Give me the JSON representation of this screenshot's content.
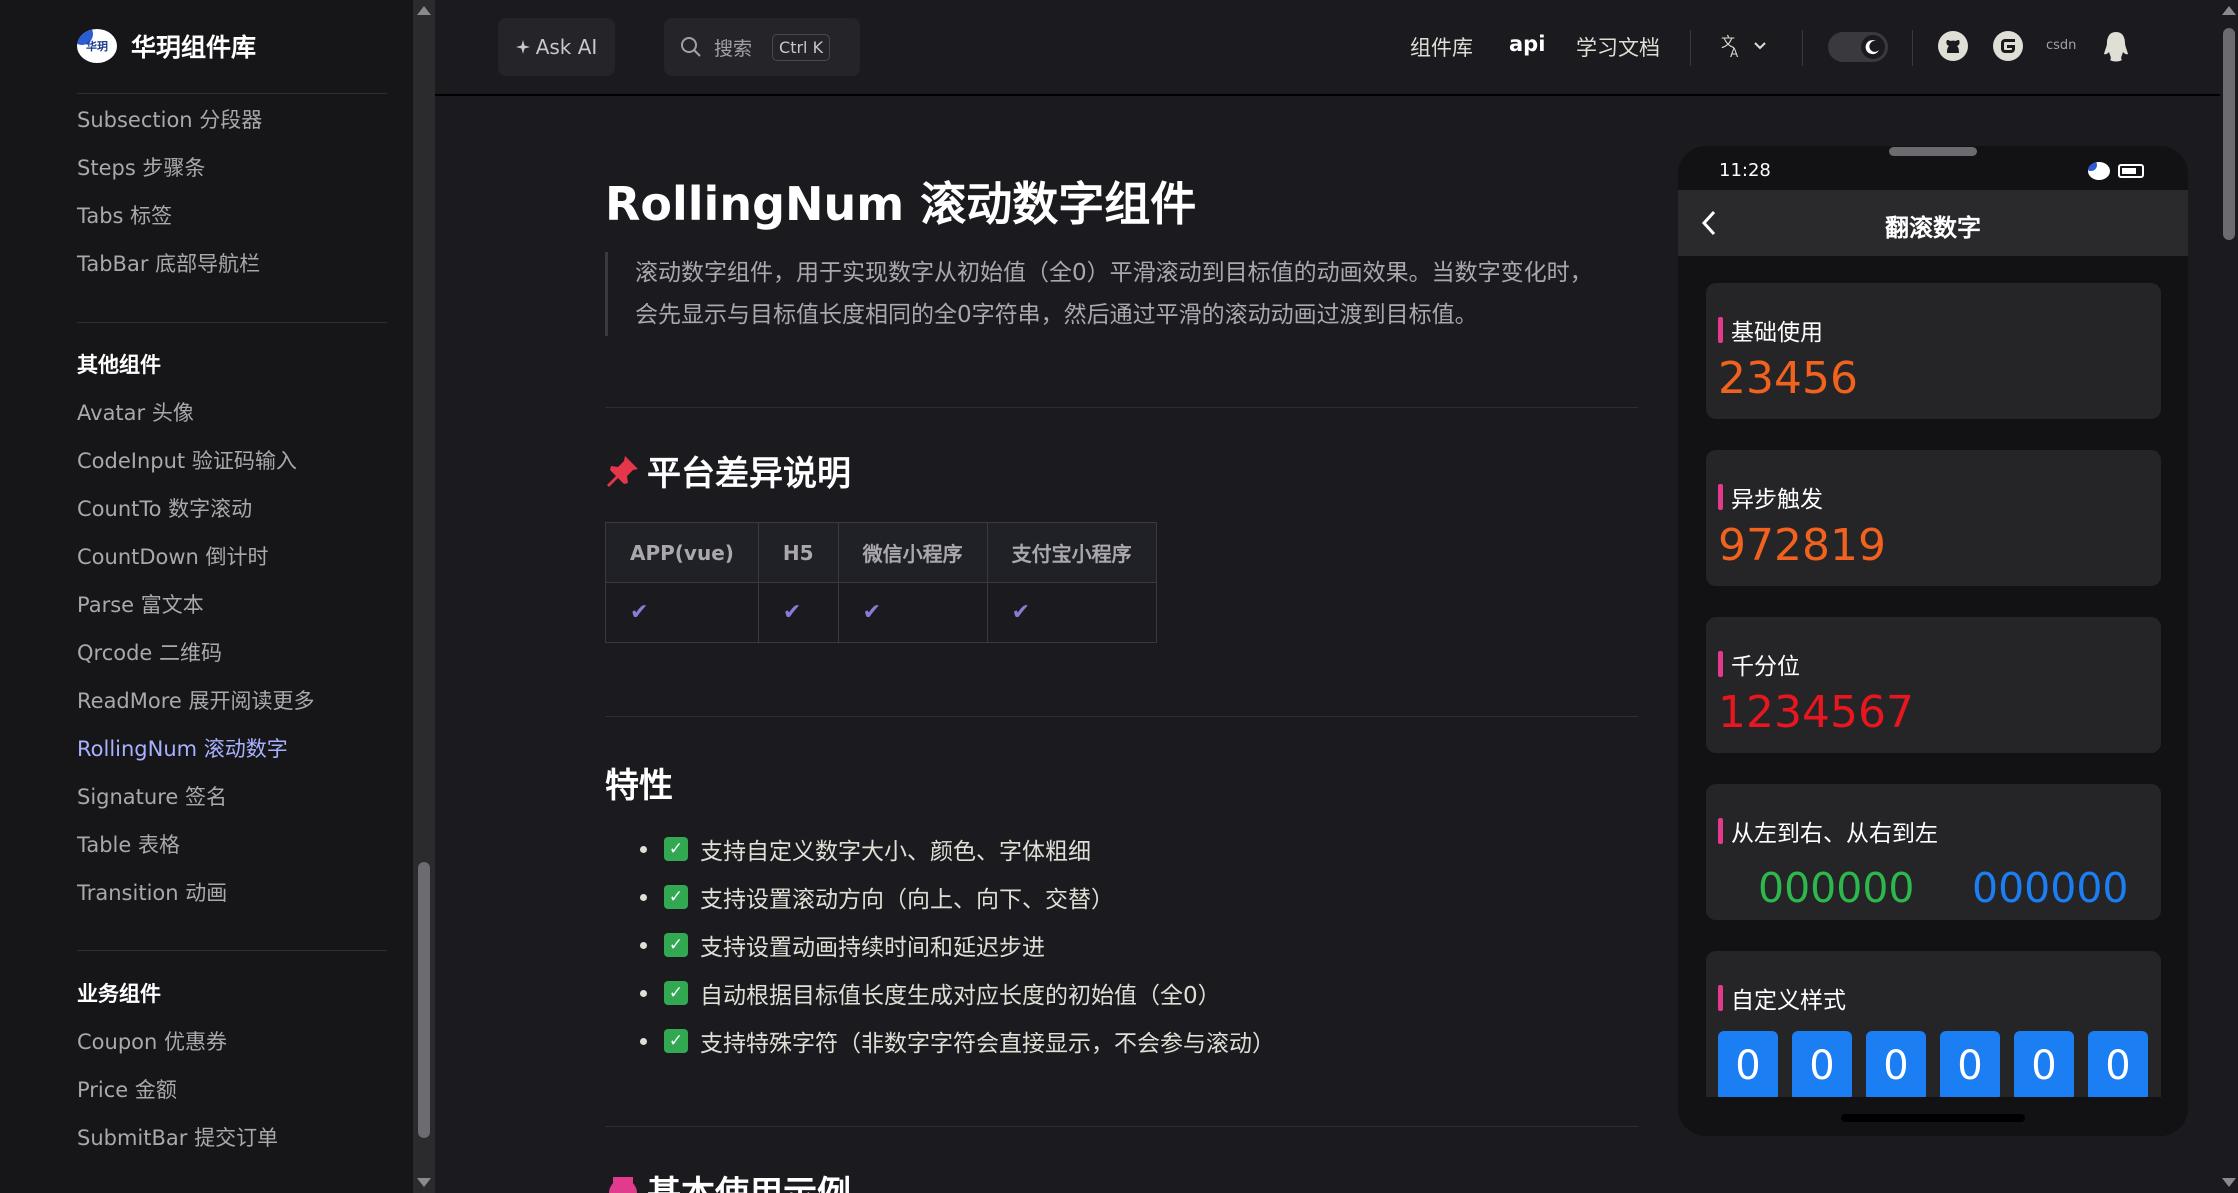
{
  "brand": {
    "name": "华玥组件库",
    "logo_text": "华玥"
  },
  "sidebar": {
    "items_top": [
      {
        "label": "Subsection 分段器"
      },
      {
        "label": "Steps 步骤条"
      },
      {
        "label": "Tabs 标签"
      },
      {
        "label": "TabBar 底部导航栏"
      }
    ],
    "group_other": "其他组件",
    "items_other": [
      {
        "label": "Avatar 头像"
      },
      {
        "label": "CodeInput 验证码输入"
      },
      {
        "label": "CountTo 数字滚动"
      },
      {
        "label": "CountDown 倒计时"
      },
      {
        "label": "Parse 富文本"
      },
      {
        "label": "Qrcode 二维码"
      },
      {
        "label": "ReadMore 展开阅读更多"
      },
      {
        "label": "RollingNum 滚动数字",
        "active": true
      },
      {
        "label": "Signature 签名"
      },
      {
        "label": "Table 表格"
      },
      {
        "label": "Transition 动画"
      }
    ],
    "group_business": "业务组件",
    "items_business": [
      {
        "label": "Coupon 优惠券"
      },
      {
        "label": "Price 金额"
      },
      {
        "label": "SubmitBar 提交订单"
      }
    ]
  },
  "topnav": {
    "ask_ai": "Ask AI",
    "search_placeholder": "搜索",
    "search_shortcut": "Ctrl K",
    "links": [
      "组件库",
      "api",
      "学习文档"
    ],
    "csdn": "csdn",
    "icons": [
      "translate-icon",
      "chevron-down-icon",
      "moon-icon",
      "github-icon",
      "gitee-icon",
      "qq-icon"
    ]
  },
  "content": {
    "title": "RollingNum 滚动数字组件",
    "intro_line1": "滚动数字组件，用于实现数字从初始值（全0）平滑滚动到目标值的动画效果。当数字变化时，",
    "intro_line2": "会先显示与目标值长度相同的全0字符串，然后通过平滑的滚动动画过渡到目标值。",
    "platform_heading": "平台差异说明",
    "platform_table": {
      "headers": [
        "APP(vue)",
        "H5",
        "微信小程序",
        "支付宝小程序"
      ],
      "row": [
        "✔",
        "✔",
        "✔",
        "✔"
      ]
    },
    "features_heading": "特性",
    "features": [
      "支持自定义数字大小、颜色、字体粗细",
      "支持设置滚动方向（向上、向下、交替）",
      "支持设置动画持续时间和延迟步进",
      "自动根据目标值长度生成对应长度的初始值（全0）",
      "支持特殊字符（非数字字符会直接显示，不会参与滚动）"
    ],
    "basic_heading": "基本使用示例"
  },
  "phone": {
    "time": "11:28",
    "nav_title": "翻滚数字",
    "cards": [
      {
        "title": "基础使用",
        "value": "23456",
        "color": "#f0621e"
      },
      {
        "title": "异步触发",
        "value": "972819",
        "color": "#f0621e"
      },
      {
        "title": "千分位",
        "value": "1234567",
        "color": "#e8161e"
      },
      {
        "title": "从左到右、从右到左",
        "left_value": "000000",
        "right_value": "000000",
        "left_color": "#2db84d",
        "right_color": "#1b7ef2"
      },
      {
        "title": "自定义样式",
        "digits": [
          "0",
          "0",
          "0",
          "0",
          "0",
          "0"
        ],
        "box_color": "#1b7ef2"
      }
    ]
  },
  "colors": {
    "accent": "#a8b1ff",
    "background": "#1b1b1f",
    "sidebar": "#161618"
  }
}
